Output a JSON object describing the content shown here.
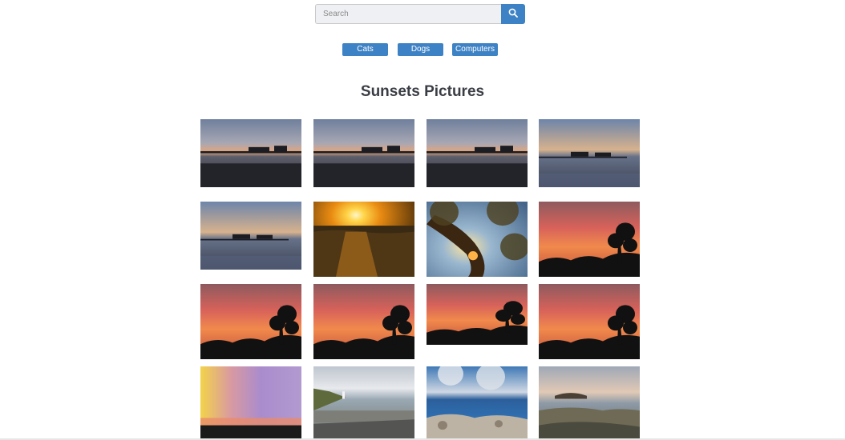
{
  "search": {
    "placeholder": "Search",
    "value": "",
    "button_icon": "search-icon"
  },
  "categories": [
    {
      "label": "Cats"
    },
    {
      "label": "Dogs"
    },
    {
      "label": "Computers"
    }
  ],
  "title": "Sunsets Pictures",
  "colors": {
    "accent": "#3d82c4",
    "title": "#3a3d44",
    "search_bg": "#eef0f3"
  },
  "gallery": [
    {
      "scene": "pier-dusk"
    },
    {
      "scene": "pier-dusk"
    },
    {
      "scene": "pier-dusk"
    },
    {
      "scene": "pier-blue"
    },
    {
      "scene": "pier-blue"
    },
    {
      "scene": "sun-over-sea"
    },
    {
      "scene": "tree-sunburst"
    },
    {
      "scene": "red-sky-tree"
    },
    {
      "scene": "red-sky-tree"
    },
    {
      "scene": "red-sky-tree"
    },
    {
      "scene": "red-sky-tree"
    },
    {
      "scene": "red-sky-tree"
    },
    {
      "scene": "watercolor-sky"
    },
    {
      "scene": "coastal-road"
    },
    {
      "scene": "rocky-beach"
    },
    {
      "scene": "rocky-coast-dusk"
    }
  ]
}
